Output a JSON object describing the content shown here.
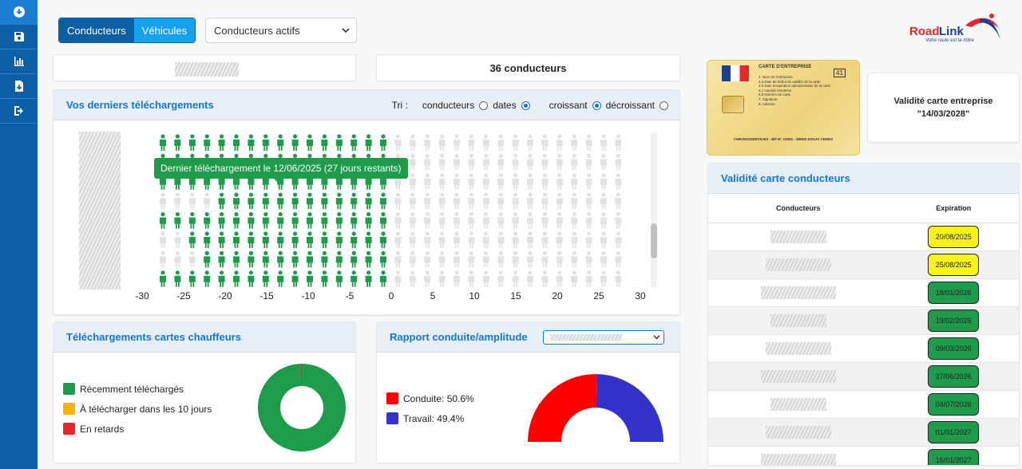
{
  "sidebar": {
    "items": [
      "download-icon",
      "save-icon",
      "chart-icon",
      "file-download-icon",
      "logout-icon"
    ]
  },
  "toolbar": {
    "conducteurs_label": "Conducteurs",
    "vehicules_label": "Véhicules",
    "filter_value": "Conducteurs actifs"
  },
  "logo": {
    "name_road": "Road",
    "name_link": "Link",
    "tagline": "Votre route est la nôtre"
  },
  "summary": {
    "count_label": "36 conducteurs"
  },
  "downloads": {
    "title": "Vos derniers téléchargements",
    "tri_label": "Tri :",
    "opt_conducteurs": "conducteurs",
    "opt_dates": "dates",
    "opt_croissant": "croissant",
    "opt_decroissant": "décroissant",
    "sort_by": "dates",
    "sort_order": "croissant",
    "tooltip": "Dernier téléchargement le 12/06/2025 (27 jours restants)",
    "axis_ticks": [
      "-30",
      "-25",
      "-20",
      "-15",
      "-10",
      "-5",
      "0",
      "5",
      "10",
      "15",
      "20",
      "25",
      "30"
    ]
  },
  "card_company": {
    "title": "CARTE D'ENTREPRISE",
    "fields": [
      "1. Nom de l'entreprise",
      "4.a Date de début de validité de la carte",
      "4.b Date d'expiration administrative de la carte",
      "4.c Autorité émettrice",
      "5.b Numéro de carte",
      "7. Signature",
      "8. Adresse"
    ],
    "issuer": "CHRONOSERVICES - BP N° 10061 - 59502 DOUAI CEDEX",
    "validity_label": "Validité carte entreprise",
    "validity_value": "\"14/03/2028\""
  },
  "drivers_validity": {
    "title": "Validité carte conducteurs",
    "col_driver": "Conducteurs",
    "col_expiration": "Expiration",
    "rows": [
      {
        "expiration": "20/08/2025",
        "status": "warning"
      },
      {
        "expiration": "25/08/2025",
        "status": "warning"
      },
      {
        "expiration": "18/01/2026",
        "status": "ok"
      },
      {
        "expiration": "19/02/2026",
        "status": "ok"
      },
      {
        "expiration": "09/03/2026",
        "status": "ok"
      },
      {
        "expiration": "27/06/2026",
        "status": "ok"
      },
      {
        "expiration": "04/07/2026",
        "status": "ok"
      },
      {
        "expiration": "01/01/2027",
        "status": "ok"
      },
      {
        "expiration": "16/01/2027",
        "status": "ok"
      }
    ]
  },
  "driver_cards_downloads": {
    "title": "Téléchargements cartes chauffeurs",
    "legend": [
      {
        "label": "Récemment téléchargés",
        "color": "#1e9b4b"
      },
      {
        "label": "À télécharger dans les 10 jours",
        "color": "#f5b400"
      },
      {
        "label": "En retards",
        "color": "#e8262b"
      }
    ]
  },
  "driving_ratio": {
    "title": "Rapport conduite/amplitude",
    "legend": [
      {
        "label": "Conduite: 50.6%",
        "color": "#ff0000"
      },
      {
        "label": "Travail: 49.4%",
        "color": "#3333cc"
      }
    ]
  },
  "colors": {
    "accent": "#1677d2",
    "ok": "#1e9b4b",
    "warning": "#f7f21a",
    "bad": "#e8262b",
    "sidebar": "#0b5fa5"
  },
  "chart_data": [
    {
      "type": "bar",
      "title": "",
      "x": [
        -30,
        -25,
        -20,
        -15,
        -10,
        -5,
        0,
        5,
        10,
        15,
        20,
        25,
        30
      ],
      "xlim": [
        -30,
        30
      ],
      "grid": false,
      "legend": "none"
    },
    {
      "type": "pie",
      "title": "",
      "categories": [
        "Récemment téléchargés",
        "À télécharger dans les 10 jours",
        "En retards"
      ],
      "values": [
        99.5,
        0,
        0.5
      ],
      "donut": true
    },
    {
      "type": "pie",
      "title": "",
      "categories": [
        "Conduite",
        "Travail"
      ],
      "values": [
        50.6,
        49.4
      ],
      "half_donut": true
    }
  ]
}
